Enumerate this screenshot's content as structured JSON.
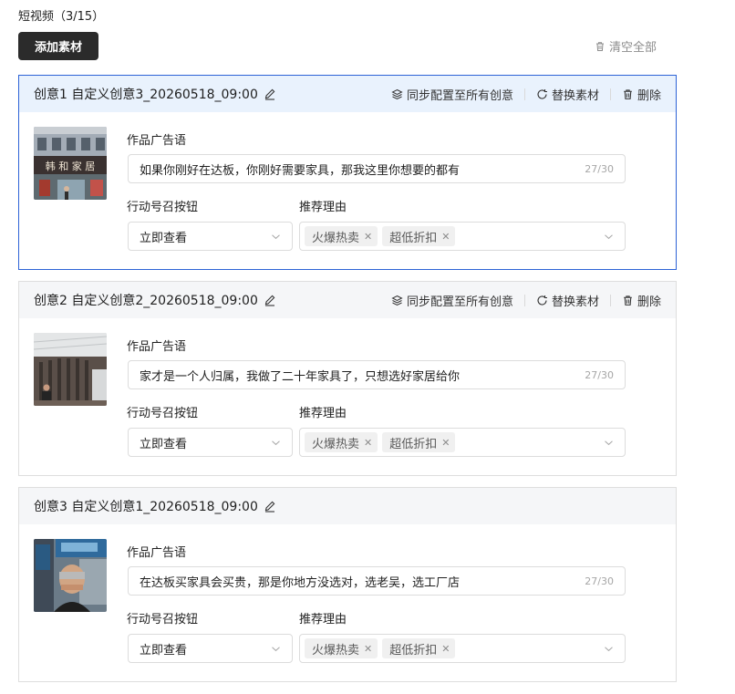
{
  "header": {
    "title": "短视频（3/15）",
    "add_label": "添加素材",
    "clear_label": "清空全部"
  },
  "labels": {
    "ad": "作品广告语",
    "cta": "行动号召按钮",
    "reason": "推荐理由"
  },
  "actions": {
    "sync": "同步配置至所有创意",
    "replace": "替换素材",
    "delete": "删除"
  },
  "cards": [
    {
      "title": "创意1 自定义创意3_20260518_09:00",
      "ad_text": "如果你刚好在达板，你刚好需要家具，那我这里你想要的都有",
      "ad_count": "27/30",
      "cta_value": "立即查看",
      "tags": [
        "火爆热卖",
        "超低折扣"
      ]
    },
    {
      "title": "创意2 自定义创意2_20260518_09:00",
      "ad_text": "家才是一个人归属，我做了二十年家具了，只想选好家居给你",
      "ad_count": "27/30",
      "cta_value": "立即查看",
      "tags": [
        "火爆热卖",
        "超低折扣"
      ]
    },
    {
      "title": "创意3 自定义创意1_20260518_09:00",
      "ad_text": "在达板买家具会买贵，那是你地方没选对，选老吴，选工厂店",
      "ad_count": "27/30",
      "cta_value": "立即查看",
      "tags": [
        "火爆热卖",
        "超低折扣"
      ]
    }
  ],
  "thumbs": {
    "store_sign": "韩 和 家 居"
  },
  "colors": {
    "selected_border": "#2d63d6",
    "selected_header": "#e9f2fd",
    "header_bg": "#f5f6f8",
    "primary_button": "#2b2b2b"
  },
  "icons": [
    "edit-pencil-icon",
    "layers-icon",
    "refresh-icon",
    "trash-icon",
    "chevron-down-icon",
    "tag-close-icon"
  ]
}
